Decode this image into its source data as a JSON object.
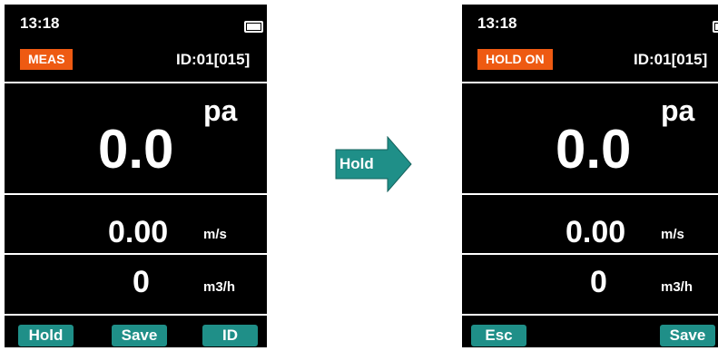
{
  "left_screen": {
    "time": "13:18",
    "mode": "MEAS",
    "device_id": "ID:01[015]",
    "pressure": {
      "value": "0.0",
      "unit": "pa"
    },
    "velocity": {
      "value": "0.00",
      "unit": "m/s"
    },
    "flow": {
      "value": "0",
      "unit": "m3/h"
    },
    "softkeys": [
      "Hold",
      "Save",
      "ID"
    ]
  },
  "transition": {
    "label": "Hold"
  },
  "right_screen": {
    "time": "13:18",
    "mode": "HOLD ON",
    "device_id": "ID:01[015]",
    "pressure": {
      "value": "0.0",
      "unit": "pa"
    },
    "velocity": {
      "value": "0.00",
      "unit": "m/s"
    },
    "flow": {
      "value": "0",
      "unit": "m3/h"
    },
    "softkeys": [
      "Esc",
      "Save"
    ]
  },
  "colors": {
    "mode_badge": "#ee5a12",
    "softkey": "#1f8f88",
    "arrow": "#1f8f88"
  }
}
